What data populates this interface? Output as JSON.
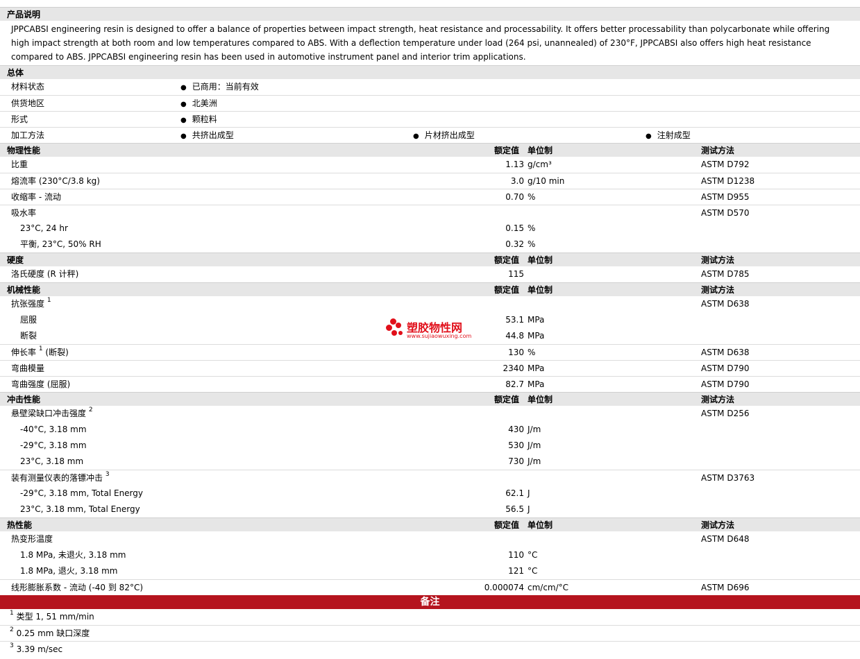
{
  "description": {
    "header": "产品说明",
    "text": "JPPCABSI engineering resin is designed to offer a balance of properties between impact strength, heat resistance and processability. It offers better processability than polycarbonate while offering high impact strength at both room and low temperatures compared to ABS. With a deflection temperature under load (264 psi, unannealed) of 230°F, JPPCABSI also offers high heat resistance compared to ABS. JPPCABSI engineering resin has been used in automotive instrument panel and interior trim applications."
  },
  "general": {
    "header": "总体",
    "status_label": "材料状态",
    "status_value": "已商用：当前有效",
    "region_label": "供货地区",
    "region_value": "北美洲",
    "form_label": "形式",
    "form_value": "颗粒料",
    "process_label": "加工方法",
    "process_values": [
      "共挤出成型",
      "片材挤出成型",
      "注射成型"
    ]
  },
  "col_headers": {
    "value": "额定值",
    "unit": "单位制",
    "method": "测试方法"
  },
  "physical": {
    "header": "物理性能",
    "rows": [
      {
        "label": "比重",
        "value": "1.13",
        "unit": "g/cm³",
        "method": "ASTM D792"
      },
      {
        "label": "熔流率  (230°C/3.8 kg)",
        "value": "3.0",
        "unit": "g/10 min",
        "method": "ASTM D1238"
      },
      {
        "label": "收缩率  - 流动",
        "value": "0.70",
        "unit": "%",
        "method": "ASTM D955"
      },
      {
        "label": "吸水率",
        "value": "",
        "unit": "",
        "method": "ASTM D570"
      },
      {
        "label": "23°C, 24 hr",
        "value": "0.15",
        "unit": "%",
        "method": ""
      },
      {
        "label": "平衡, 23°C, 50% RH",
        "value": "0.32",
        "unit": "%",
        "method": ""
      }
    ]
  },
  "hardness": {
    "header": "硬度",
    "rows": [
      {
        "label": "洛氏硬度  (R 计秤)",
        "value": "115",
        "unit": "",
        "method": "ASTM D785"
      }
    ]
  },
  "mechanical": {
    "header": "机械性能",
    "rows": [
      {
        "label": "抗张强度",
        "sup": "1",
        "value": "",
        "unit": "",
        "method": "ASTM D638"
      },
      {
        "label": "屈服",
        "value": "53.1",
        "unit": "MPa",
        "method": ""
      },
      {
        "label": "断裂",
        "value": "44.8",
        "unit": "MPa",
        "method": ""
      },
      {
        "label": "伸长率",
        "sup": "1",
        "suffix": " (断裂)",
        "value": "130",
        "unit": "%",
        "method": "ASTM D638"
      },
      {
        "label": "弯曲模量",
        "value": "2340",
        "unit": "MPa",
        "method": "ASTM D790"
      },
      {
        "label": "弯曲强度  (屈服)",
        "value": "82.7",
        "unit": "MPa",
        "method": "ASTM D790"
      }
    ]
  },
  "impact": {
    "header": "冲击性能",
    "rows": [
      {
        "label": "悬壁梁缺口冲击强度",
        "sup": "2",
        "value": "",
        "unit": "",
        "method": "ASTM D256"
      },
      {
        "label": "-40°C, 3.18 mm",
        "value": "430",
        "unit": "J/m",
        "method": ""
      },
      {
        "label": "-29°C, 3.18 mm",
        "value": "530",
        "unit": "J/m",
        "method": ""
      },
      {
        "label": "23°C, 3.18 mm",
        "value": "730",
        "unit": "J/m",
        "method": ""
      },
      {
        "label": "装有测量仪表的落镖冲击",
        "sup": "3",
        "value": "",
        "unit": "",
        "method": "ASTM D3763"
      },
      {
        "label": "-29°C, 3.18 mm, Total Energy",
        "value": "62.1",
        "unit": "J",
        "method": ""
      },
      {
        "label": "23°C, 3.18 mm, Total Energy",
        "value": "56.5",
        "unit": "J",
        "method": ""
      }
    ]
  },
  "thermal": {
    "header": "热性能",
    "rows": [
      {
        "label": "热变形温度",
        "value": "",
        "unit": "",
        "method": "ASTM D648"
      },
      {
        "label": "1.8 MPa, 未退火, 3.18 mm",
        "value": "110",
        "unit": "°C",
        "method": ""
      },
      {
        "label": "1.8 MPa, 退火, 3.18 mm",
        "value": "121",
        "unit": "°C",
        "method": ""
      },
      {
        "label": "线形膨胀系数  - 流动  (-40 到  82°C)",
        "value": "0.000074",
        "unit": "cm/cm/°C",
        "method": "ASTM D696"
      }
    ]
  },
  "notes": {
    "header": "备注",
    "items": [
      {
        "num": "1",
        "text": "类型  1, 51 mm/min"
      },
      {
        "num": "2",
        "text": "0.25 mm 缺口深度"
      },
      {
        "num": "3",
        "text": "3.39 m/sec"
      }
    ]
  },
  "watermark": {
    "title": "塑胶物性网",
    "url": "www.sujiaowuxing.com",
    "color": "#e10f1a"
  }
}
